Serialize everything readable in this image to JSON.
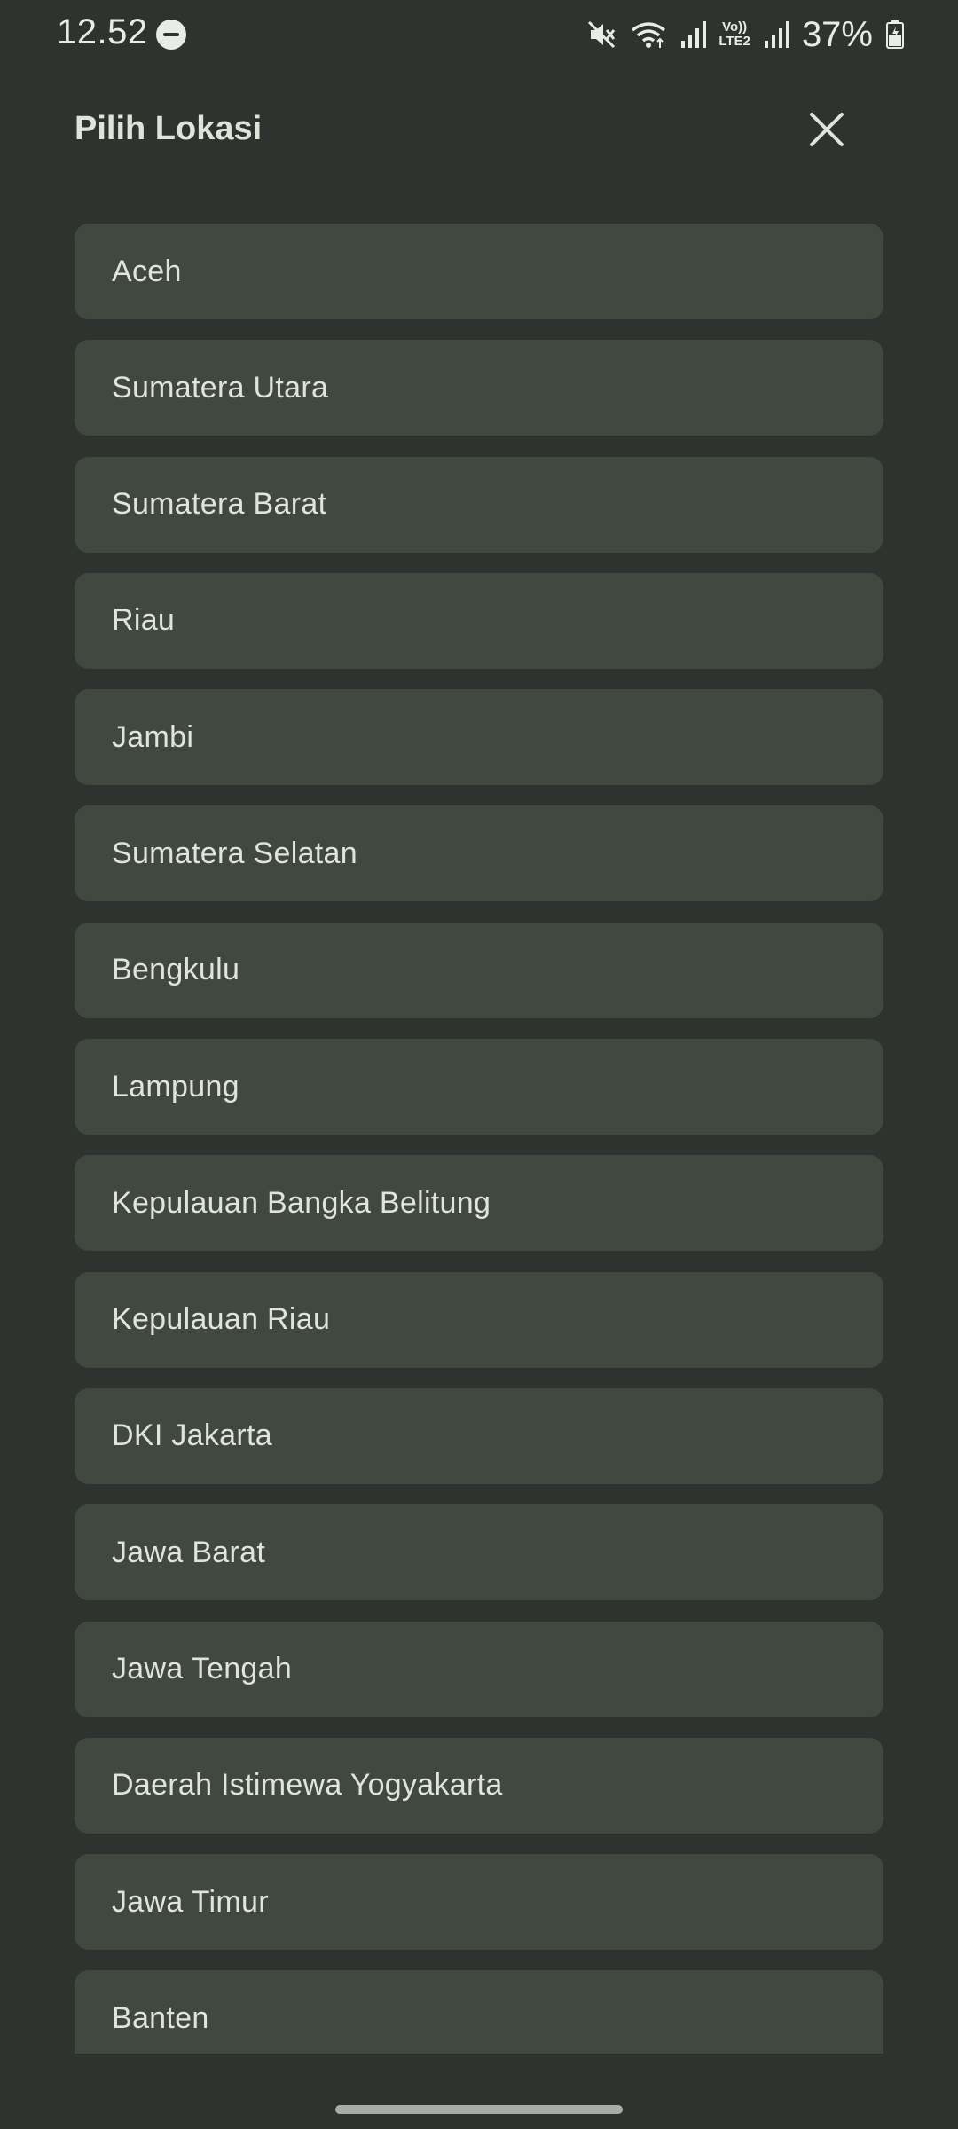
{
  "status_bar": {
    "time": "12.52",
    "battery": "37%",
    "volte_top": "Vo))",
    "volte_bottom": "LTE2"
  },
  "header": {
    "title": "Pilih Lokasi"
  },
  "locations": [
    "Aceh",
    "Sumatera Utara",
    "Sumatera Barat",
    "Riau",
    "Jambi",
    "Sumatera Selatan",
    "Bengkulu",
    "Lampung",
    "Kepulauan Bangka Belitung",
    "Kepulauan Riau",
    "DKI Jakarta",
    "Jawa Barat",
    "Jawa Tengah",
    "Daerah Istimewa Yogyakarta",
    "Jawa Timur",
    "Banten"
  ],
  "colors": {
    "background": "#2f332f",
    "list_item": "#414840",
    "text": "#e0e4dc"
  }
}
